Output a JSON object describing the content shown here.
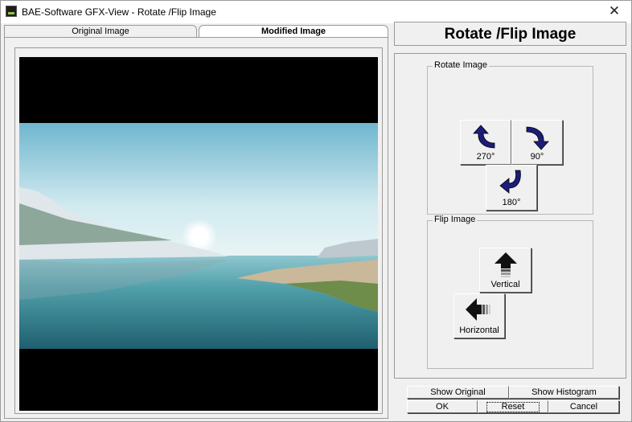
{
  "window": {
    "title": "BAE-Software GFX-View - Rotate /Flip Image",
    "close_glyph": "✕"
  },
  "tabs": [
    {
      "label": "Original Image",
      "selected": false
    },
    {
      "label": "Modified Image",
      "selected": true
    }
  ],
  "header": {
    "title": "Rotate /Flip Image"
  },
  "rotate_group": {
    "legend": "Rotate Image",
    "buttons": {
      "r270": "270°",
      "r90": "90°",
      "r180": "180°"
    }
  },
  "flip_group": {
    "legend": "Flip Image",
    "buttons": {
      "vertical": "Vertical",
      "horizontal": "Horizontal"
    }
  },
  "actions": {
    "show_original": "Show Original",
    "show_histogram": "Show Histogram",
    "ok": "OK",
    "reset": "Reset",
    "cancel": "Cancel"
  },
  "icons": {
    "app": "app-icon",
    "close": "close-icon",
    "rotate_270": "rotate-ccw-arrow-icon",
    "rotate_90": "rotate-cw-arrow-icon",
    "rotate_180": "rotate-180-arrow-icon",
    "flip_vertical": "flip-vertical-arrow-icon",
    "flip_horizontal": "flip-horizontal-arrow-icon"
  },
  "colors": {
    "arrow": "#1c1c7a",
    "sky": "#a9d8e8",
    "water": "#3f8e9c"
  }
}
